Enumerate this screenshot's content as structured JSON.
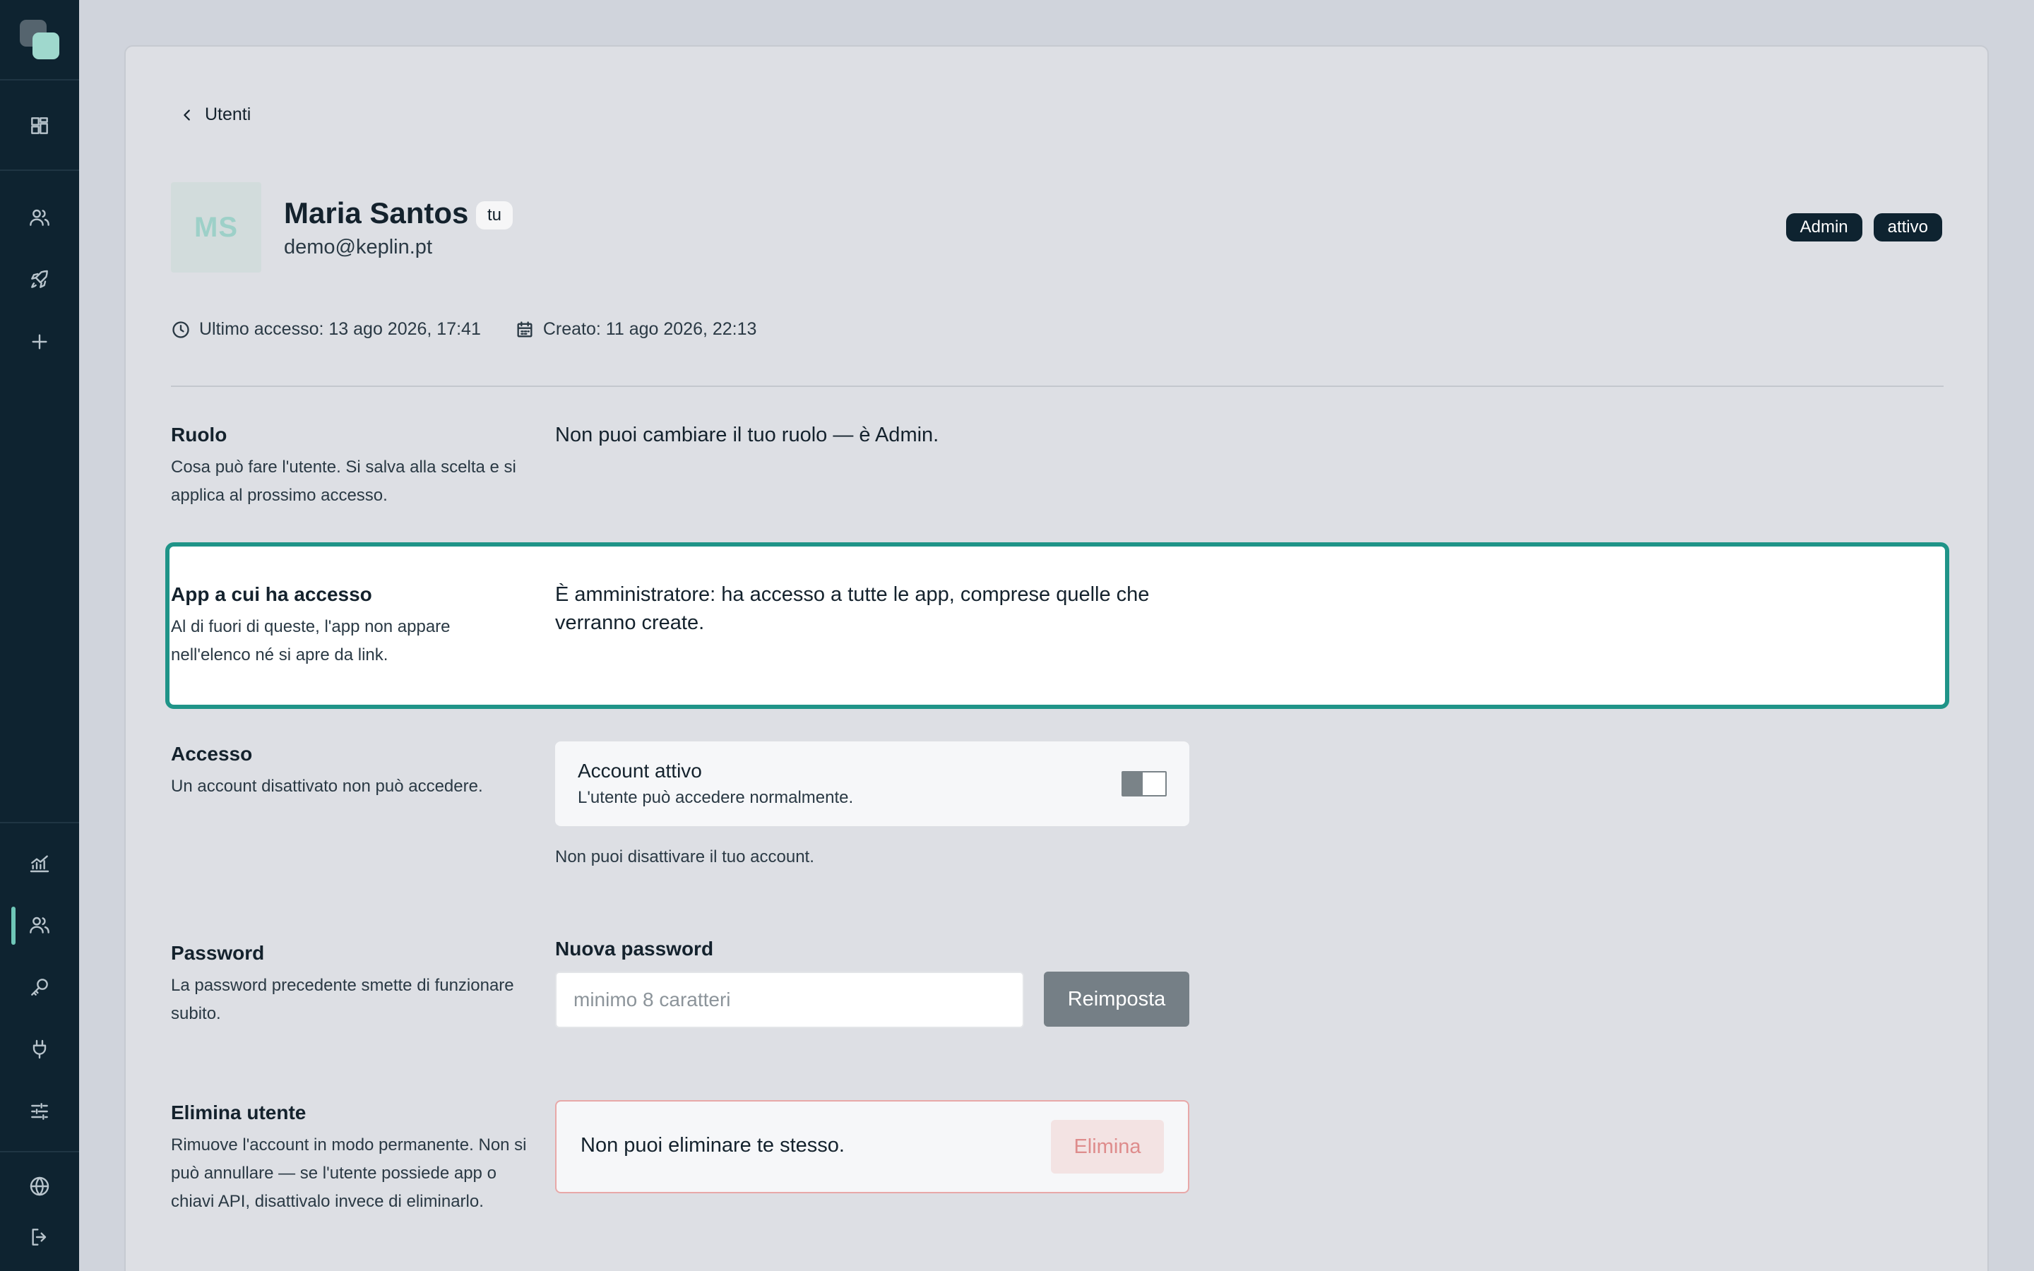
{
  "sidebar": {
    "icons": [
      "dashboard-icon",
      "users-icon",
      "rocket-icon",
      "plus-icon",
      "analytics-icon",
      "users-icon",
      "key-icon",
      "plug-icon",
      "sliders-icon",
      "globe-icon",
      "logout-icon"
    ],
    "active_item": "users",
    "accent_color": "#6fc7b8"
  },
  "breadcrumb": {
    "back_label": "Utenti"
  },
  "user": {
    "initials": "MS",
    "name": "Maria Santos",
    "you_badge": "tu",
    "email": "demo@keplin.pt",
    "role_badge": "Admin",
    "status_badge": "attivo",
    "last_access": "Ultimo accesso: 13 ago 2026, 17:41",
    "created": "Creato: 11 ago 2026, 22:13"
  },
  "sections": {
    "role": {
      "title": "Ruolo",
      "description": "Cosa può fare l'utente. Si salva alla scelta e si applica al prossimo accesso.",
      "content": "Non puoi cambiare il tuo ruolo — è Admin."
    },
    "apps": {
      "title": "App a cui ha accesso",
      "description": "Al di fuori di queste, l'app non appare nell'elenco né si apre da link.",
      "content": "È amministratore: ha accesso a tutte le app, comprese quelle che verranno create.",
      "highlight_color": "#1f9488"
    },
    "access": {
      "title": "Accesso",
      "description": "Un account disattivato non può accedere.",
      "toggle_title": "Account attivo",
      "toggle_subtitle": "L'utente può accedere normalmente.",
      "note": "Non puoi disattivare il tuo account."
    },
    "password": {
      "title": "Password",
      "description": "La password precedente smette di funzionare subito.",
      "field_label": "Nuova password",
      "placeholder": "minimo 8 caratteri",
      "button_label": "Reimposta"
    },
    "delete": {
      "title": "Elimina utente",
      "description": "Rimuove l'account in modo permanente. Non si può annullare — se l'utente possiede app o chiavi API, disattivalo invece di eliminarlo.",
      "message": "Non puoi eliminare te stesso.",
      "button_label": "Elimina",
      "danger_color": "#e8a8a8"
    }
  }
}
